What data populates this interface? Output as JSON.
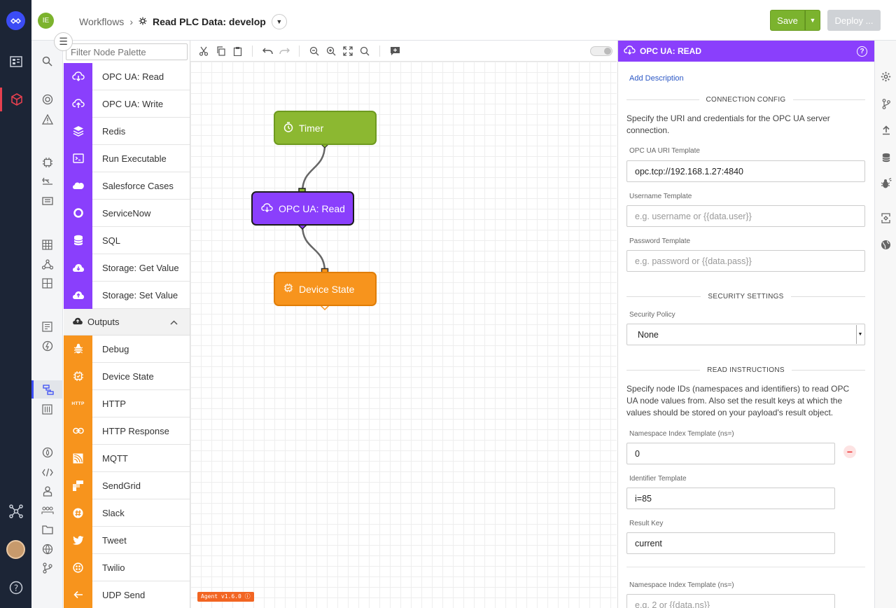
{
  "header": {
    "org_initials": "IE",
    "breadcrumb_root": "Workflows",
    "breadcrumb_sep": "›",
    "workflow_name": "Read PLC Data: develop",
    "save_label": "Save",
    "deploy_label": "Deploy ..."
  },
  "palette": {
    "filter_placeholder": "Filter Node Palette",
    "items_top": [
      {
        "label": "OPC UA: Read",
        "icon": "cloud-read-icon"
      },
      {
        "label": "OPC UA: Write",
        "icon": "cloud-write-icon"
      },
      {
        "label": "Redis",
        "icon": "layers-icon"
      },
      {
        "label": "Run Executable",
        "icon": "terminal-icon"
      },
      {
        "label": "Salesforce Cases",
        "icon": "salesforce-icon"
      },
      {
        "label": "ServiceNow",
        "icon": "servicenow-icon"
      },
      {
        "label": "SQL",
        "icon": "database-icon"
      },
      {
        "label": "Storage: Get Value",
        "icon": "cloud-download-icon"
      },
      {
        "label": "Storage: Set Value",
        "icon": "cloud-upload-icon"
      }
    ],
    "outputs_group": "Outputs",
    "items_outputs": [
      {
        "label": "Debug",
        "icon": "bug-icon"
      },
      {
        "label": "Device State",
        "icon": "device-state-icon"
      },
      {
        "label": "HTTP",
        "icon": "http-icon",
        "badge": "HTTP"
      },
      {
        "label": "HTTP Response",
        "icon": "link-icon"
      },
      {
        "label": "MQTT",
        "icon": "mqtt-icon"
      },
      {
        "label": "SendGrid",
        "icon": "sendgrid-icon"
      },
      {
        "label": "Slack",
        "icon": "slack-icon"
      },
      {
        "label": "Tweet",
        "icon": "twitter-icon"
      },
      {
        "label": "Twilio",
        "icon": "twilio-icon"
      },
      {
        "label": "UDP Send",
        "icon": "arrow-left-icon"
      }
    ]
  },
  "canvas": {
    "nodes": {
      "timer": "Timer",
      "opcua": "OPC UA: Read",
      "device_state": "Device State"
    },
    "agent_badge": "Agent v1.6.0 ⓘ"
  },
  "panel": {
    "title": "OPC UA: READ",
    "add_description": "Add Description",
    "connection_config": "CONNECTION CONFIG",
    "connection_text": "Specify the URI and credentials for the OPC UA server connection.",
    "uri_label": "OPC UA URI Template",
    "uri_value": "opc.tcp://192.168.1.27:4840",
    "username_label": "Username Template",
    "username_placeholder": "e.g. username or {{data.user}}",
    "password_label": "Password Template",
    "password_placeholder": "e.g. password or {{data.pass}}",
    "security_settings": "SECURITY SETTINGS",
    "security_policy_label": "Security Policy",
    "security_policy_value": "None",
    "read_instructions": "READ INSTRUCTIONS",
    "read_text": "Specify node IDs (namespaces and identifiers) to read OPC UA node values from. Also set the result keys at which the values should be stored on your payload's result object.",
    "ns_label": "Namespace Index Template (ns=)",
    "ns_value": "0",
    "identifier_label": "Identifier Template",
    "identifier_value": "i=85",
    "result_key_label": "Result Key",
    "result_key_value": "current",
    "ns2_label": "Namespace Index Template (ns=)",
    "ns2_placeholder": "e.g. 2 or {{data.ns}}"
  },
  "colors": {
    "accent": "#3b4cf5",
    "purple": "#8a3ffc",
    "orange": "#f7941d",
    "green": "#8cb831",
    "save": "#7bb32e"
  }
}
